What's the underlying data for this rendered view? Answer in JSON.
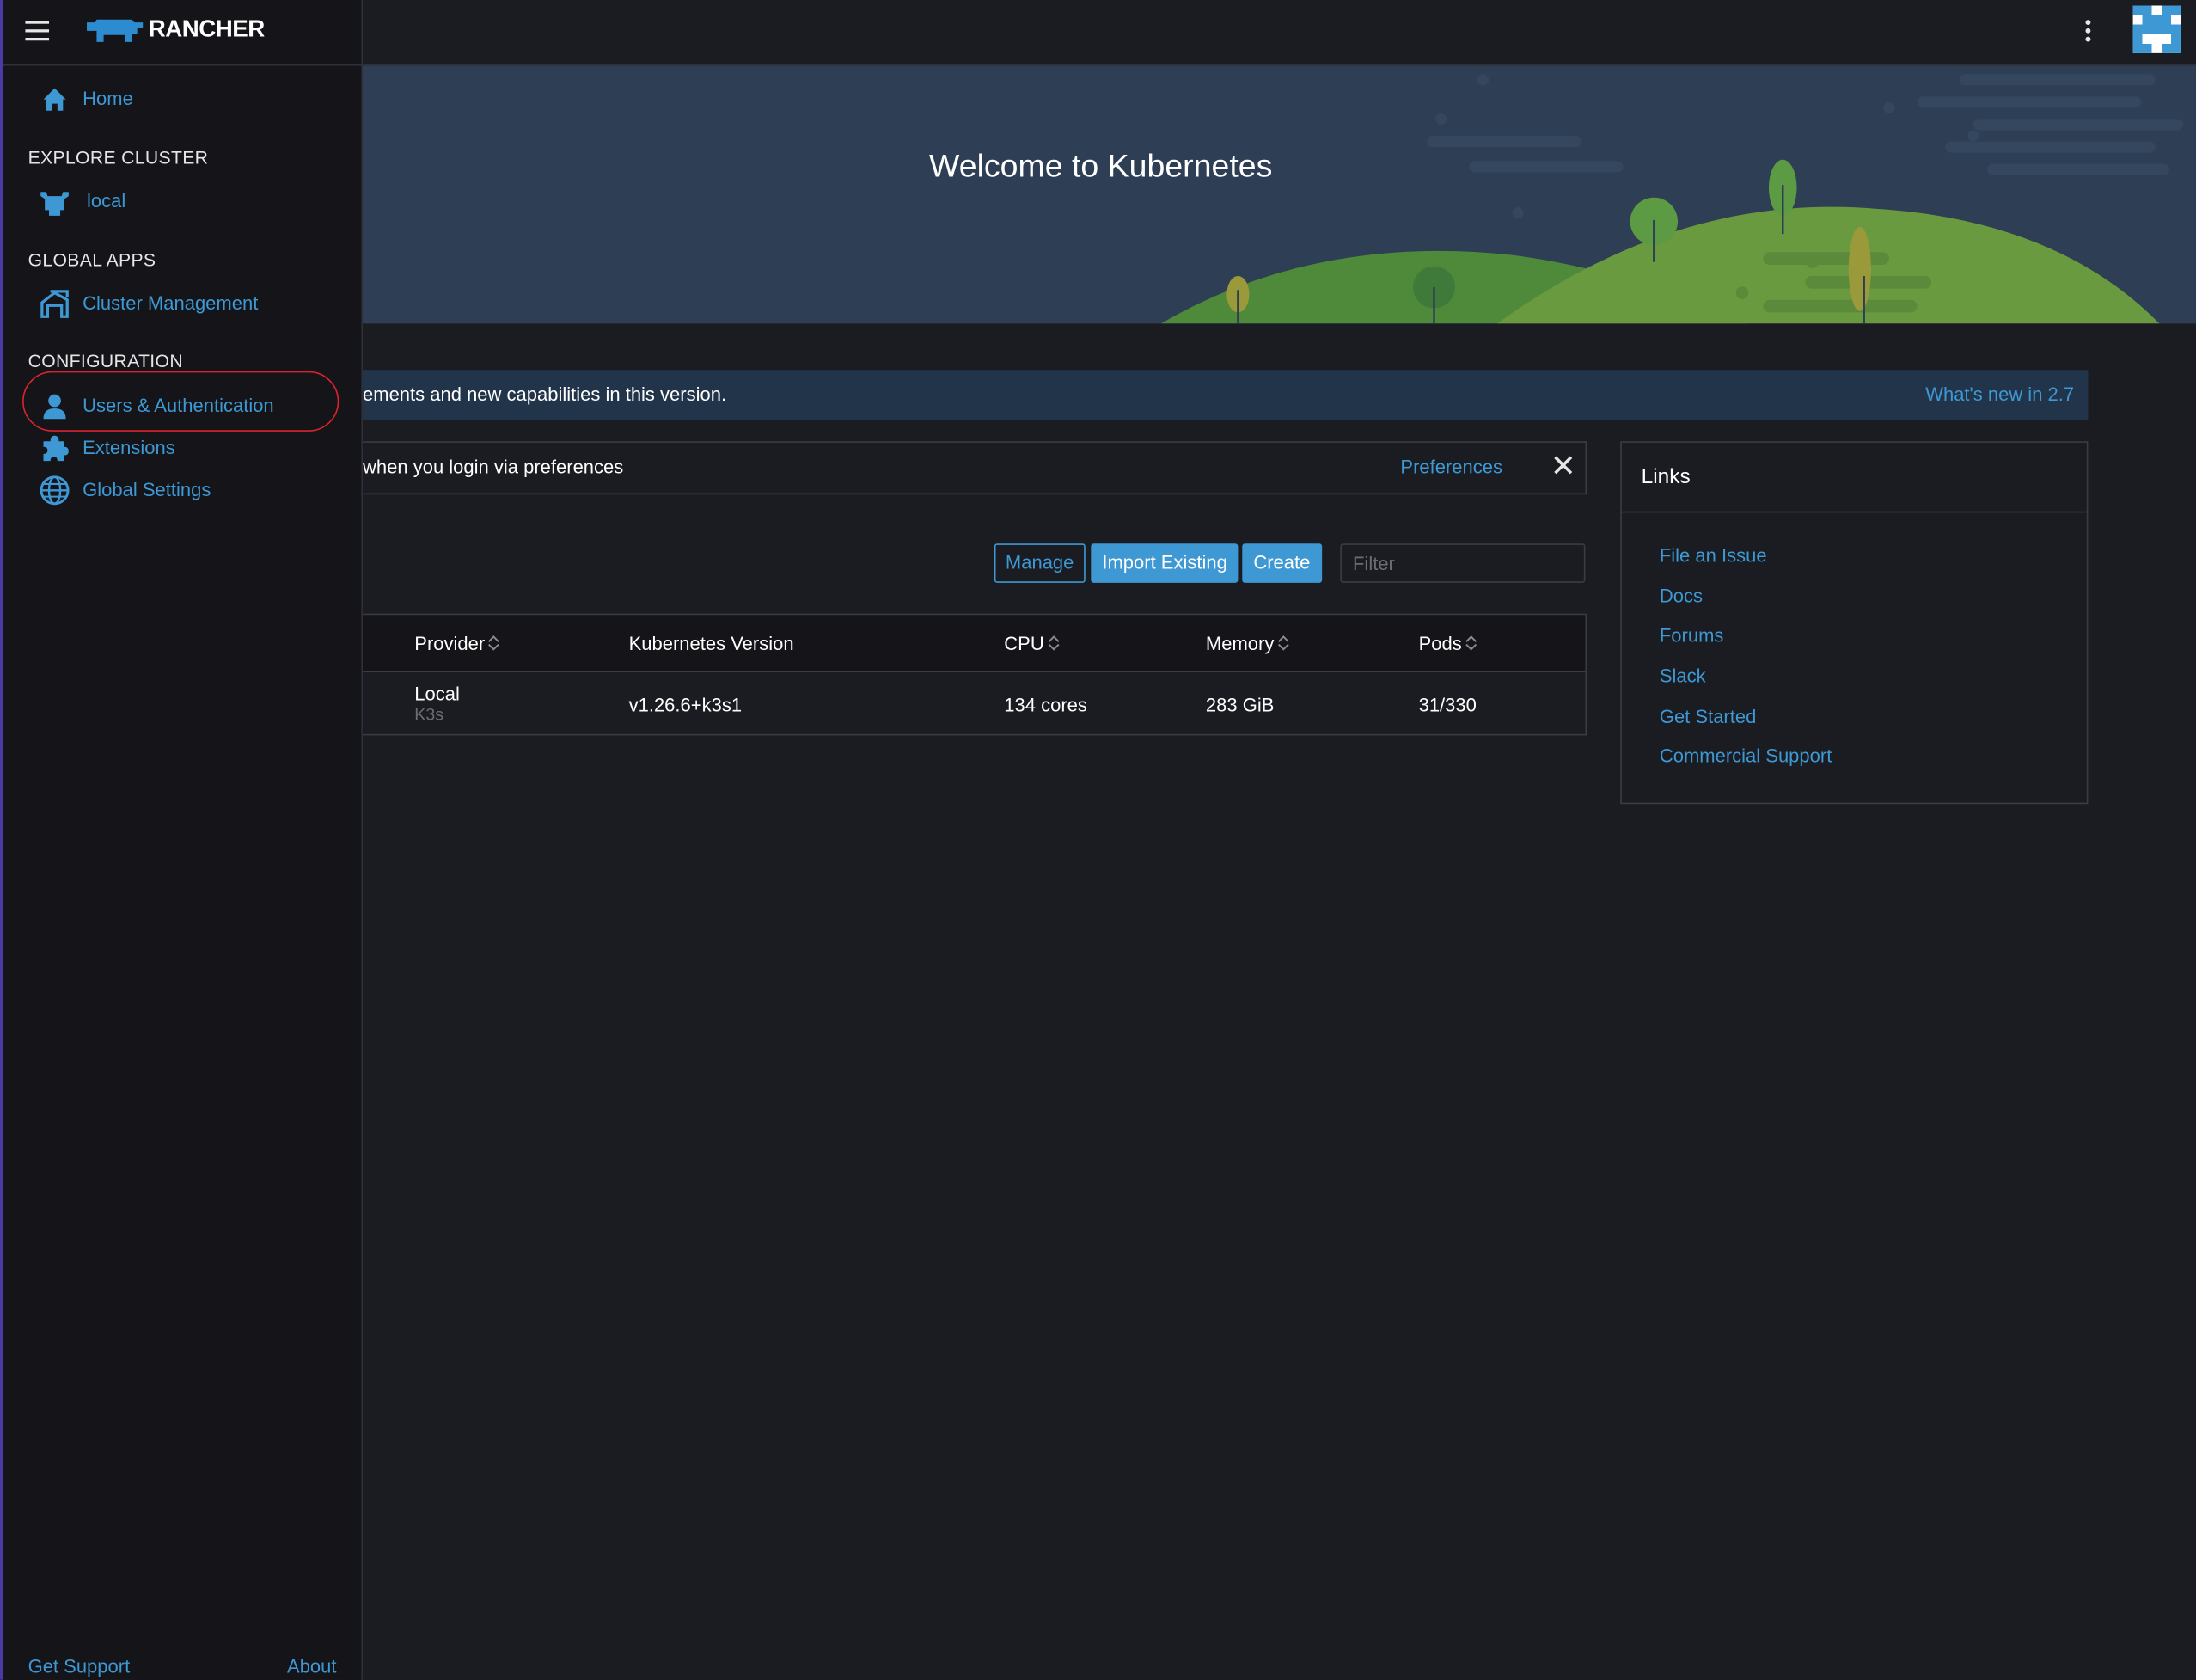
{
  "header": {
    "brand": "RANCHER",
    "menu_icon": "hamburger-icon",
    "more_icon": "vertical-ellipsis-icon",
    "avatar_icon": "user-avatar-icon"
  },
  "sidebar": {
    "home": "Home",
    "sections": [
      {
        "title": "EXPLORE CLUSTER",
        "items": [
          {
            "label": "local",
            "icon": "cluster-cow-icon"
          }
        ]
      },
      {
        "title": "GLOBAL APPS",
        "items": [
          {
            "label": "Cluster Management",
            "icon": "cluster-management-icon"
          }
        ]
      },
      {
        "title": "CONFIGURATION",
        "items": [
          {
            "label": "Users & Authentication",
            "icon": "user-icon"
          },
          {
            "label": "Extensions",
            "icon": "puzzle-icon"
          },
          {
            "label": "Global Settings",
            "icon": "globe-icon"
          }
        ]
      }
    ],
    "footer": {
      "support": "Get Support",
      "about": "About"
    }
  },
  "banner": {
    "title": "Welcome to Kubernetes"
  },
  "notice": {
    "text": "ements and new capabilities in this version.",
    "link": "What's new in 2.7"
  },
  "prefs": {
    "text": "when you login via preferences",
    "link": "Preferences",
    "close": "✕"
  },
  "toolbar": {
    "manage": "Manage",
    "import": "Import Existing",
    "create": "Create",
    "filter_placeholder": "Filter"
  },
  "table": {
    "headers": {
      "provider": "Provider",
      "version": "Kubernetes Version",
      "cpu": "CPU",
      "memory": "Memory",
      "pods": "Pods"
    },
    "rows": [
      {
        "provider": "Local",
        "provider_sub": "K3s",
        "version": "v1.26.6+k3s1",
        "cpu": "134 cores",
        "memory": "283 GiB",
        "pods": "31/330"
      }
    ]
  },
  "links": {
    "title": "Links",
    "items": [
      "File an Issue",
      "Docs",
      "Forums",
      "Slack",
      "Get Started",
      "Commercial Support"
    ]
  },
  "colors": {
    "accent": "#3d98d3",
    "highlight": "#d9232e",
    "background": "#1b1c21",
    "sidebar": "#141419"
  }
}
